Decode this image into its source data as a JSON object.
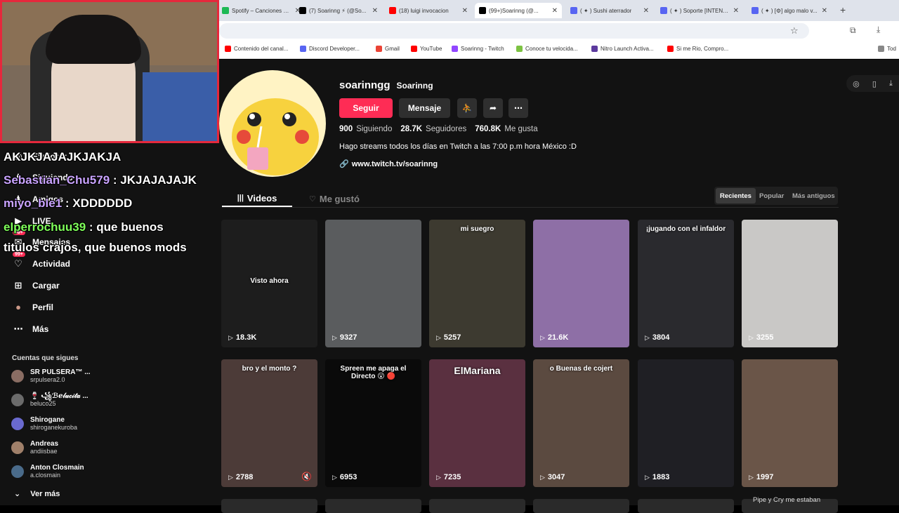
{
  "browser": {
    "tabs": [
      {
        "title": "Spotify – Canciones que...",
        "fav": "#1db954"
      },
      {
        "title": "(7) Soarinng ⚡ (@So...",
        "fav": "#000000"
      },
      {
        "title": "(18) luigi invocacion",
        "fav": "#ff0000"
      },
      {
        "title": "(99+)Soarinng (@...",
        "fav": "#000000"
      },
      {
        "title": "( ✦ ) Sushi aterrador",
        "fav": "#5865f2"
      },
      {
        "title": "( ✦ ) Soporte [INTENT...",
        "fav": "#5865f2"
      },
      {
        "title": "( ✦ ) [⚙] algo malo v...",
        "fav": "#5865f2"
      }
    ],
    "bookmarks": [
      {
        "label": "Contenido del canal...",
        "fav": "#ff0000"
      },
      {
        "label": "Discord Developer...",
        "fav": "#5865f2"
      },
      {
        "label": "Gmail",
        "fav": "#ea4335"
      },
      {
        "label": "YouTube",
        "fav": "#ff0000"
      },
      {
        "label": "Soarinng - Twitch",
        "fav": "#9146ff"
      },
      {
        "label": "Conoce tu velocida...",
        "fav": "#7cc242"
      },
      {
        "label": "Nitro Launch Activa...",
        "fav": "#5c3a9e"
      },
      {
        "label": "Si me Rio, Compro...",
        "fav": "#ff0000"
      },
      {
        "label": "Tod",
        "fav": "#888888"
      }
    ]
  },
  "sidebar": {
    "items": [
      {
        "label": "Explorar",
        "icon": "compass-icon"
      },
      {
        "label": "Siguiendo",
        "icon": "following-icon"
      },
      {
        "label": "Amigos",
        "icon": "friends-icon"
      },
      {
        "label": "LIVE",
        "icon": "live-icon"
      },
      {
        "label": "Mensajes",
        "icon": "message-icon",
        "badge": "99+"
      },
      {
        "label": "Actividad",
        "icon": "activity-icon",
        "badge": "99+"
      },
      {
        "label": "Cargar",
        "icon": "upload-icon"
      },
      {
        "label": "Perfil",
        "icon": "profile-avatar"
      },
      {
        "label": "Más",
        "icon": "more-icon"
      }
    ],
    "following_title": "Cuentas que sigues",
    "accounts": [
      {
        "name": "SR PULSERA™ ...",
        "handle": "srpulsera2.0",
        "color": "#8a6d63"
      },
      {
        "name": "🍷 ꧁ℬℯ𝓁𝓊𝒸𝒾𝓉𝒶 ...",
        "handle": "beluco25",
        "color": "#6b6b6b"
      },
      {
        "name": "Shirogane",
        "handle": "shiroganekuroba",
        "color": "#6a6acf"
      },
      {
        "name": "Andreas",
        "handle": "andiisbae",
        "color": "#a0806a"
      },
      {
        "name": "Anton Closmain",
        "handle": "a.closmain",
        "color": "#4a6b8a"
      }
    ],
    "see_more": "Ver más"
  },
  "profile": {
    "username": "soarinngg",
    "display_name": "Soarinng",
    "follow_label": "Seguir",
    "message_label": "Mensaje",
    "stats": [
      {
        "value": "900",
        "label": "Siguiendo"
      },
      {
        "value": "28.7K",
        "label": "Seguidores"
      },
      {
        "value": "760.8K",
        "label": "Me gusta"
      }
    ],
    "bio": "Hago streams todos los días en Twitch a las 7:00 p.m hora México :D",
    "link": "www.twitch.tv/soarinng"
  },
  "tabs": {
    "videos": "Videos",
    "liked": "Me gustó"
  },
  "sort": [
    "Recientes",
    "Popular",
    "Más antiguos"
  ],
  "videos": [
    {
      "views": "18.3K",
      "overlay": "Visto ahora",
      "color": "#1d1d1d"
    },
    {
      "views": "9327",
      "overlay": "",
      "color": "#5a5c5e"
    },
    {
      "views": "5257",
      "overlay": "mi suegro",
      "color": "#3d3a30"
    },
    {
      "views": "21.6K",
      "overlay": "",
      "color": "#8e6fa6"
    },
    {
      "views": "3804",
      "overlay": "¡jugando con el infaldor",
      "color": "#2a2a2e"
    },
    {
      "views": "3255",
      "overlay": "",
      "color": "#c9c8c6"
    },
    {
      "views": "2788",
      "overlay": "bro y el monto ?",
      "color": "#4c3b38"
    },
    {
      "views": "6953",
      "overlay": "Spreen me apaga el Directo 😮 🔴",
      "color": "#0a0a0a"
    },
    {
      "views": "7235",
      "overlay": "ElMariana",
      "color": "#5a3040"
    },
    {
      "views": "3047",
      "overlay": "o Buenas de cojert",
      "color": "#5b4a40"
    },
    {
      "views": "1883",
      "overlay": "",
      "color": "#1f1f24"
    },
    {
      "views": "1997",
      "overlay": "",
      "color": "#6a5548"
    }
  ],
  "bottom_caption": "Pipe y Cry me estaban",
  "chat": [
    {
      "user": "",
      "msg": "AKJKJAJAJKJAKJA",
      "color": "#ffffff"
    },
    {
      "user": "Sebastian_Chu579",
      "msg": " : JKJAJAJAJK",
      "color": "#c9a3ff"
    },
    {
      "user": "miyo_ble1",
      "msg": " : XDDDDDD",
      "color": "#c9a3ff"
    },
    {
      "user": "elperrochuu39",
      "msg": " : que buenos",
      "color": "#7fff5a"
    },
    {
      "user": "",
      "msg": "titulos crajos, que buenos mods",
      "color": "#ffffff"
    }
  ]
}
